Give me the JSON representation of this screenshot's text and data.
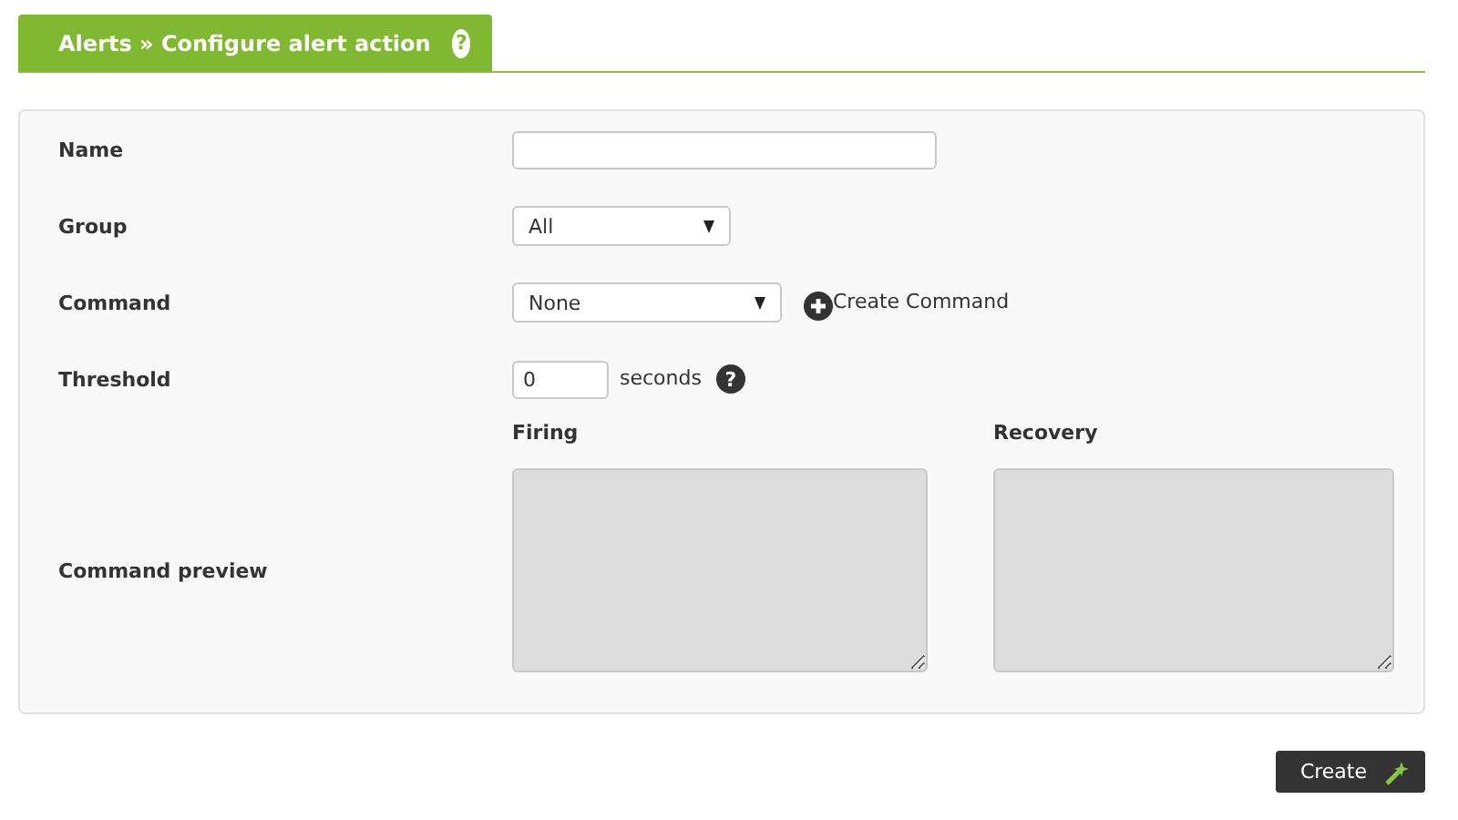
{
  "header": {
    "title": "Alerts » Configure alert action",
    "help": "?"
  },
  "fields": [
    {
      "kind": "text",
      "label": "Name"
    },
    {
      "kind": "select",
      "label": "Group",
      "value": "All"
    },
    {
      "kind": "select",
      "label": "Command",
      "value": "None",
      "action": "Create Command"
    },
    {
      "kind": "number",
      "label": "Threshold",
      "value": "0",
      "unit": "seconds",
      "help": "?"
    }
  ],
  "preview": {
    "label": "Command preview",
    "columns": [
      {
        "heading": "Firing",
        "disabled": true
      },
      {
        "heading": "Recovery",
        "disabled": true
      }
    ]
  },
  "buttons": [
    "Create"
  ]
}
